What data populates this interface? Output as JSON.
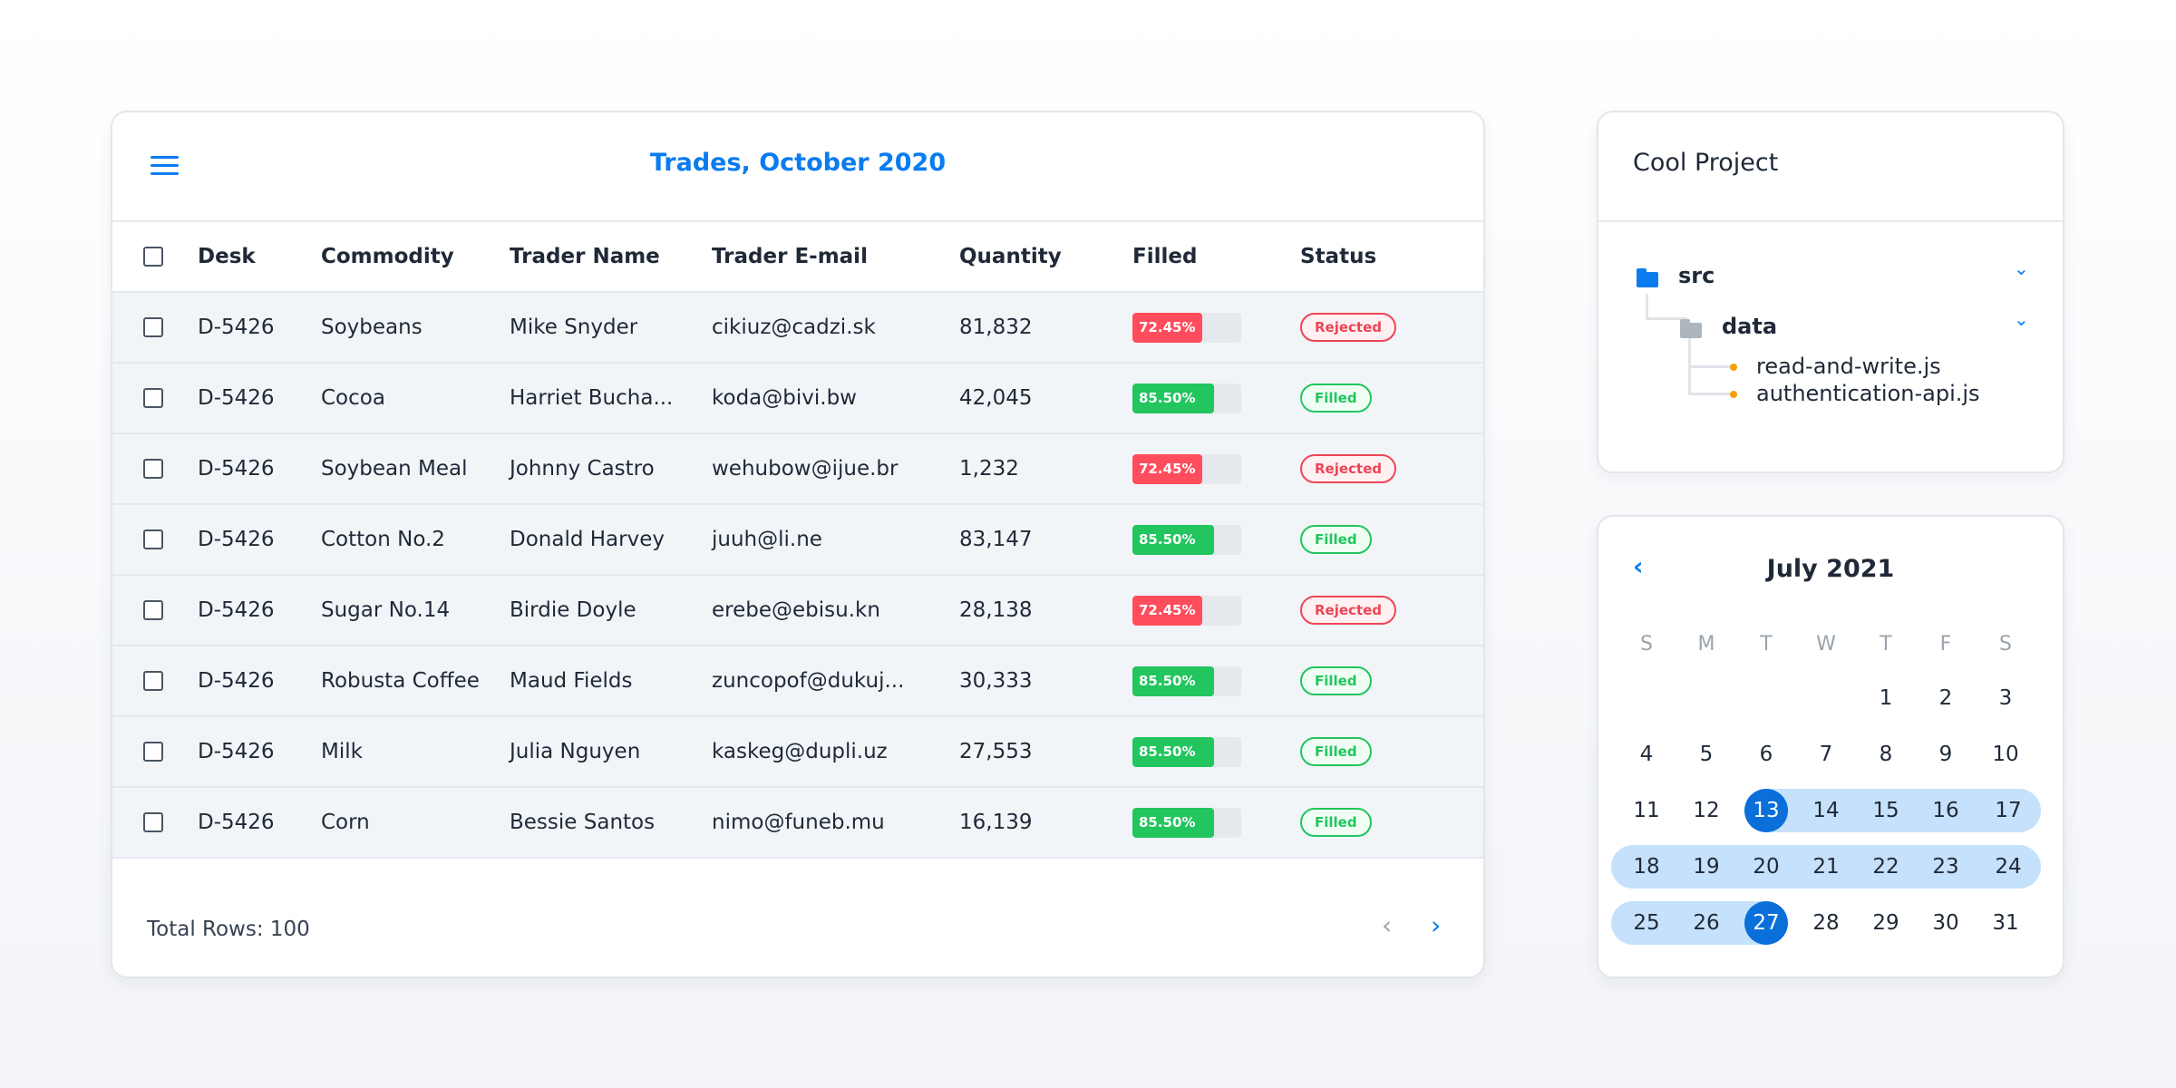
{
  "table": {
    "title": "Trades, October 2020",
    "columns": [
      "Desk",
      "Commodity",
      "Trader Name",
      "Trader E-mail",
      "Quantity",
      "Filled",
      "Status"
    ],
    "rows": [
      {
        "desk": "D-5426",
        "commodity": "Soybeans",
        "trader": "Mike Snyder",
        "email": "cikiuz@cadzi.sk",
        "quantity": "81,832",
        "filled": "72.45%",
        "filled_value": 72.45,
        "status": "Rejected"
      },
      {
        "desk": "D-5426",
        "commodity": "Cocoa",
        "trader": "Harriet Bucha...",
        "email": "koda@bivi.bw",
        "quantity": "42,045",
        "filled": "85.50%",
        "filled_value": 85.5,
        "status": "Filled"
      },
      {
        "desk": "D-5426",
        "commodity": "Soybean Meal",
        "trader": "Johnny Castro",
        "email": "wehubow@ijue.br",
        "quantity": "1,232",
        "filled": "72.45%",
        "filled_value": 72.45,
        "status": "Rejected"
      },
      {
        "desk": "D-5426",
        "commodity": "Cotton No.2",
        "trader": "Donald Harvey",
        "email": "juuh@li.ne",
        "quantity": "83,147",
        "filled": "85.50%",
        "filled_value": 85.5,
        "status": "Filled"
      },
      {
        "desk": "D-5426",
        "commodity": "Sugar No.14",
        "trader": "Birdie Doyle",
        "email": "erebe@ebisu.kn",
        "quantity": "28,138",
        "filled": "72.45%",
        "filled_value": 72.45,
        "status": "Rejected"
      },
      {
        "desk": "D-5426",
        "commodity": "Robusta Coffee",
        "trader": "Maud Fields",
        "email": "zuncopof@dukuj...",
        "quantity": "30,333",
        "filled": "85.50%",
        "filled_value": 85.5,
        "status": "Filled"
      },
      {
        "desk": "D-5426",
        "commodity": "Milk",
        "trader": "Julia Nguyen",
        "email": "kaskeg@dupli.uz",
        "quantity": "27,553",
        "filled": "85.50%",
        "filled_value": 85.5,
        "status": "Filled"
      },
      {
        "desk": "D-5426",
        "commodity": "Corn",
        "trader": "Bessie Santos",
        "email": "nimo@funeb.mu",
        "quantity": "16,139",
        "filled": "85.50%",
        "filled_value": 85.5,
        "status": "Filled"
      }
    ],
    "footer": "Total Rows: 100",
    "prev_icon": "‹",
    "next_icon": "›"
  },
  "colors": {
    "accent": "#0a7cf0",
    "rejected": "#ff4d5e",
    "filled": "#22c55e",
    "range": "#c5e1fb",
    "range_edge": "#0a6fd9"
  },
  "project": {
    "title": "Cool Project",
    "tree": [
      {
        "name": "src",
        "type": "folder",
        "color": "#0a7cf0",
        "expanded": true
      },
      {
        "name": "data",
        "type": "folder",
        "color": "#adb5bd",
        "expanded": true
      },
      {
        "name": "read-and-write.js",
        "type": "file"
      },
      {
        "name": "authentication-api.js",
        "type": "file"
      }
    ],
    "chevron": "⌄"
  },
  "calendar": {
    "title": "July 2021",
    "prev_icon": "‹",
    "weekdays": [
      "S",
      "M",
      "T",
      "W",
      "T",
      "F",
      "S"
    ],
    "first_weekday": 4,
    "days_in_month": 31,
    "range_start": 13,
    "range_end": 27
  }
}
